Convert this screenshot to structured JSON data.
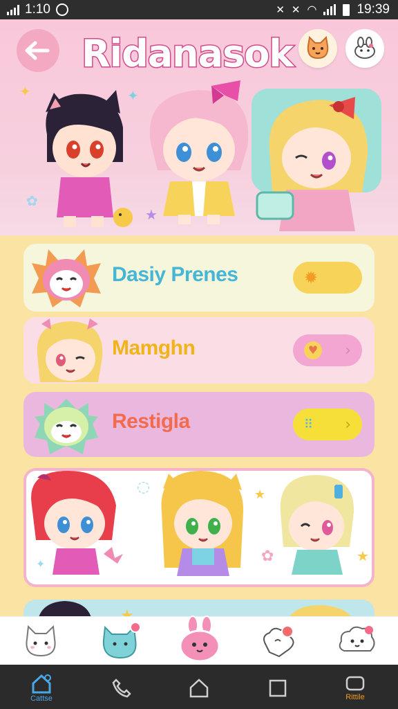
{
  "status_bar": {
    "left_time": "1:10",
    "right_time": "19:39"
  },
  "header": {
    "title": "Ridanasok"
  },
  "list": {
    "items": [
      {
        "label": "Dasiy Prenes",
        "label_color": "#45b6d6",
        "bg": "#f5f6dc",
        "pill_color": "#f7d35a",
        "pill_icon": "sun-icon"
      },
      {
        "label": "Mamghn",
        "label_color": "#f1b418",
        "bg": "#fbdde6",
        "pill_color": "#f3a6d1",
        "pill_icon": "heart-icon"
      },
      {
        "label": "Restigla",
        "label_color": "#f36b4c",
        "bg": "#eab8df",
        "pill_color": "#f7df3a",
        "pill_icon": "paw-icon"
      }
    ]
  },
  "bottom_nav": {
    "home_label": "Cattse",
    "right_label": "Rittile"
  },
  "colors": {
    "accent_pink": "#f3a6c4",
    "accent_yellow": "#f7d35a",
    "bg_yellow": "#fbe3a4"
  }
}
